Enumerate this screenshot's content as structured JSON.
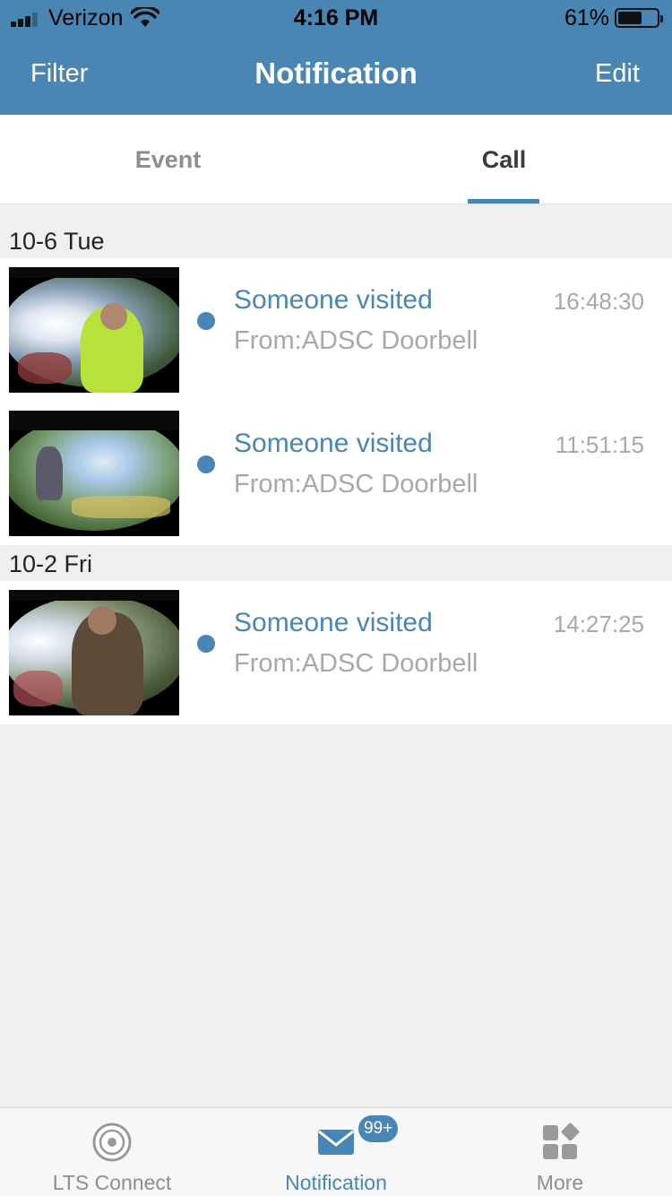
{
  "status_bar": {
    "carrier": "Verizon",
    "time": "4:16 PM",
    "battery_percent": "61%",
    "battery_level": 0.61,
    "signal_icon": "signal-bars-icon",
    "wifi_icon": "wifi-icon"
  },
  "nav": {
    "left": "Filter",
    "title": "Notification",
    "right": "Edit"
  },
  "tabs": [
    {
      "label": "Event",
      "active": false
    },
    {
      "label": "Call",
      "active": true
    }
  ],
  "sections": [
    {
      "header": "10-6 Tue",
      "items": [
        {
          "title": "Someone visited",
          "source": "From:ADSC Doorbell",
          "time": "16:48:30",
          "unread": true
        },
        {
          "title": "Someone visited",
          "source": "From:ADSC Doorbell",
          "time": "11:51:15",
          "unread": true
        }
      ]
    },
    {
      "header": "10-2 Fri",
      "items": [
        {
          "title": "Someone visited",
          "source": "From:ADSC Doorbell",
          "time": "14:27:25",
          "unread": true
        }
      ]
    }
  ],
  "tabbar": {
    "items": [
      {
        "label": "LTS Connect",
        "icon": "camera-lens-icon",
        "active": false
      },
      {
        "label": "Notification",
        "icon": "envelope-icon",
        "active": true,
        "badge": "99+"
      },
      {
        "label": "More",
        "icon": "grid-icon",
        "active": false
      }
    ]
  },
  "colors": {
    "accent": "#4a86b4",
    "secondary_text": "#a8a8a8",
    "background": "#efefef"
  }
}
